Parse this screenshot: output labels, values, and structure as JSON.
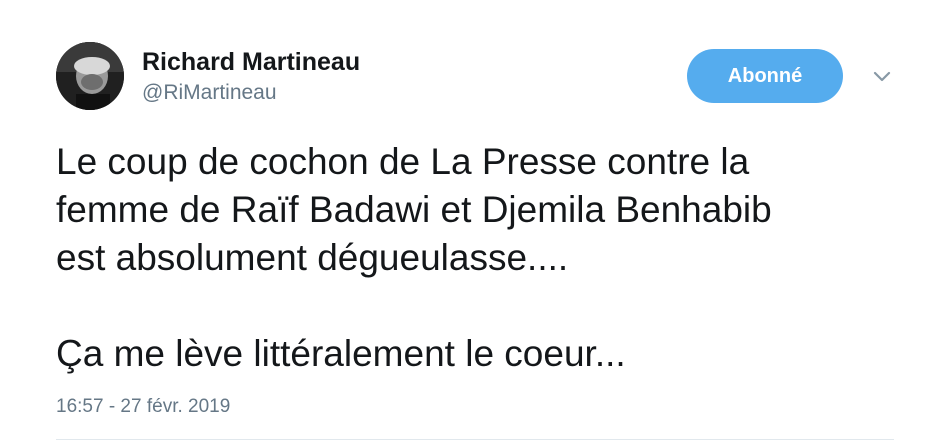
{
  "author": {
    "display_name": "Richard Martineau",
    "handle": "@RiMartineau",
    "avatar": "profile-photo"
  },
  "follow_button": {
    "label": "Abonné",
    "color": "#55acee"
  },
  "menu": {
    "icon": "chevron-down-icon"
  },
  "tweet": {
    "paragraph_1": "Le coup de cochon de La Presse contre la\nfemme de Raïf Badawi et Djemila Benhabib\nest absolument dégueulasse....",
    "paragraph_2": "Ça me lève littéralement le coeur...",
    "timestamp": "16:57 - 27 févr. 2019"
  },
  "colors": {
    "text": "#14171a",
    "secondary_text": "#657786",
    "divider": "#e1e8ed"
  }
}
